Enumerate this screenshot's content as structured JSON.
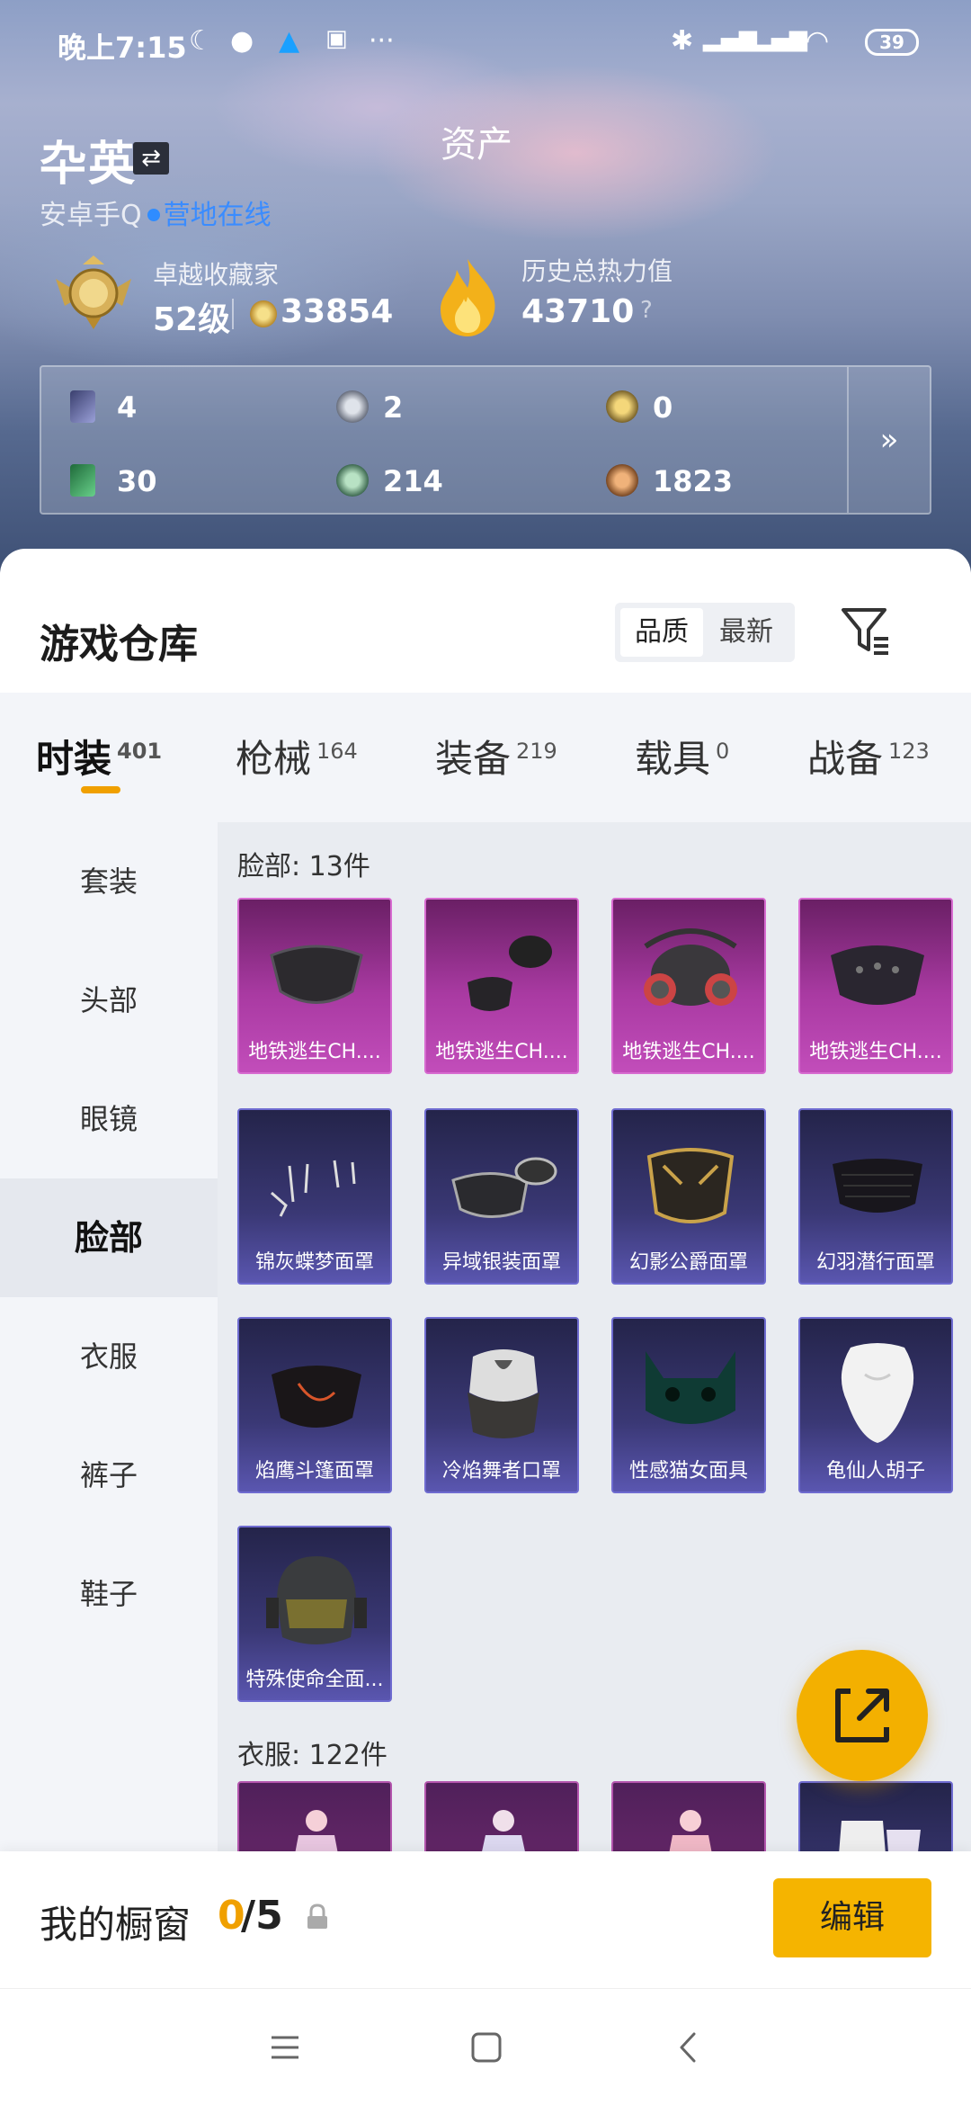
{
  "status": {
    "time": "晚上7:15",
    "battery": "39"
  },
  "header": {
    "player_name": "卆英",
    "title": "资产",
    "platform": "安卓手Q",
    "online": "营地在线",
    "rank_label": "卓越收藏家",
    "rank_level": "52级",
    "coins": "33854",
    "heat_label": "历史总热力值",
    "heat_value": "43710",
    "help": "?"
  },
  "stats": [
    {
      "icon": "purple-card-icon",
      "value": "4"
    },
    {
      "icon": "silver-medal-icon",
      "value": "2"
    },
    {
      "icon": "gold-medal-icon",
      "value": "0"
    },
    {
      "icon": "green-card-icon",
      "value": "30"
    },
    {
      "icon": "green-coin-icon",
      "value": "214"
    },
    {
      "icon": "bronze-coin-icon",
      "value": "1823"
    }
  ],
  "stats_more": "»",
  "warehouse": {
    "title": "游戏仓库",
    "sort": [
      "品质",
      "最新"
    ],
    "tabs": [
      {
        "label": "时装",
        "count": "401"
      },
      {
        "label": "枪械",
        "count": "164"
      },
      {
        "label": "装备",
        "count": "219"
      },
      {
        "label": "载具",
        "count": "0"
      },
      {
        "label": "战备",
        "count": "123"
      }
    ],
    "sidebar": [
      "套装",
      "头部",
      "眼镜",
      "脸部",
      "衣服",
      "裤子",
      "鞋子"
    ],
    "face_section": "脸部: 13件",
    "face_items": [
      "地铁逃生CH....",
      "地铁逃生CH....",
      "地铁逃生CH....",
      "地铁逃生CH....",
      "锦灰蝶梦面罩",
      "异域银装面罩",
      "幻影公爵面罩",
      "幻羽潜行面罩",
      "焰鹰斗篷面罩",
      "冷焰舞者口罩",
      "性感猫女面具",
      "龟仙人胡子",
      "特殊使命全面..."
    ],
    "clothes_section": "衣服: 122件"
  },
  "showcase": {
    "label": "我的橱窗",
    "current": "0",
    "total": "/5",
    "edit": "编辑"
  },
  "colors": {
    "accent": "#f5b400",
    "online": "#3a8cff",
    "rarity_pink": "#c24dba",
    "rarity_blue": "#5a56b0"
  }
}
